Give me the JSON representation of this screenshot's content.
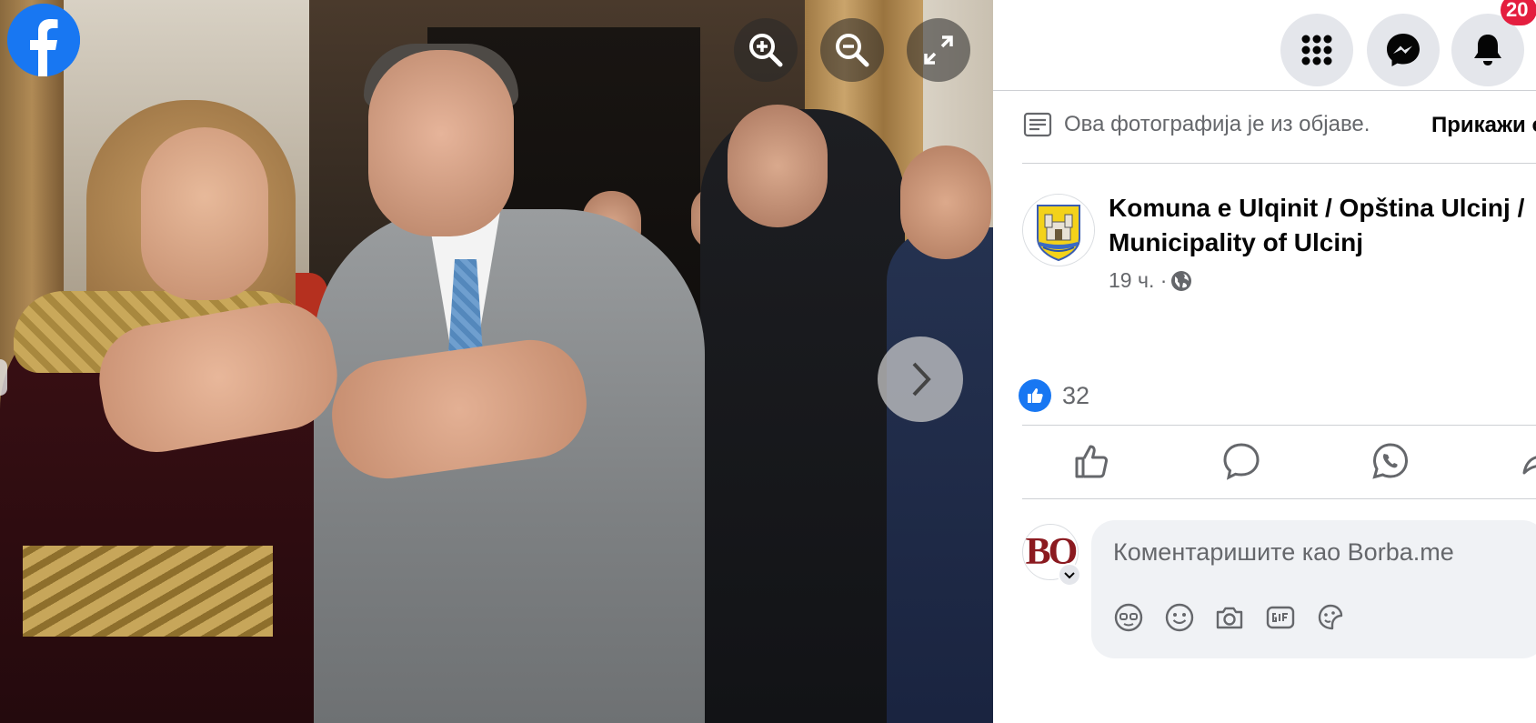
{
  "viewer": {
    "zoom_in_icon": "zoom-in-icon",
    "zoom_out_icon": "zoom-out-icon",
    "fullscreen_icon": "expand-icon",
    "next_icon": "chevron-right-icon"
  },
  "header": {
    "notification_count": "20"
  },
  "post_source": {
    "note": "Ова фотографија је из објаве.",
    "show_post": "Прикажи објаву"
  },
  "page": {
    "name_line1": "Komuna e Ulqinit / Opština Ulcinj /",
    "name_line2": "Municipality of Ulcinj",
    "time": "19 ч. ·"
  },
  "reactions": {
    "like_count": "32"
  },
  "comment": {
    "avatar_text": "BO",
    "placeholder": "Коментаришите као Borba.me"
  },
  "colors": {
    "brand": "#1877f2",
    "badge": "#e41e3f",
    "muted_text": "#65676b"
  }
}
